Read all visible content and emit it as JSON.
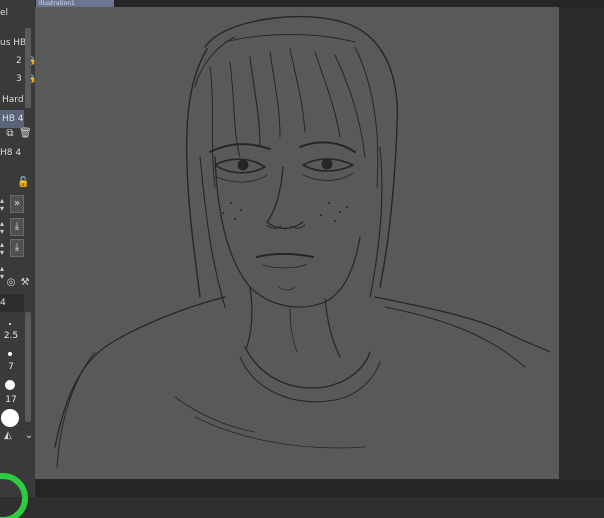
{
  "window": {
    "tab_title": "Illustration1"
  },
  "left_panel": {
    "rows": [
      {
        "label": "el"
      },
      {
        "label": "us HB"
      },
      {
        "label": "2"
      },
      {
        "label": "3"
      },
      {
        "label": "Hard"
      },
      {
        "label": "HB 4"
      },
      {
        "label": "H8 4"
      }
    ],
    "number_field": "4",
    "brush_sizes": [
      "2.5",
      "7",
      "17"
    ]
  },
  "colors": {
    "accent_green": "#2ecc40",
    "canvas_gray": "#595959",
    "selection": "#5a6478"
  }
}
